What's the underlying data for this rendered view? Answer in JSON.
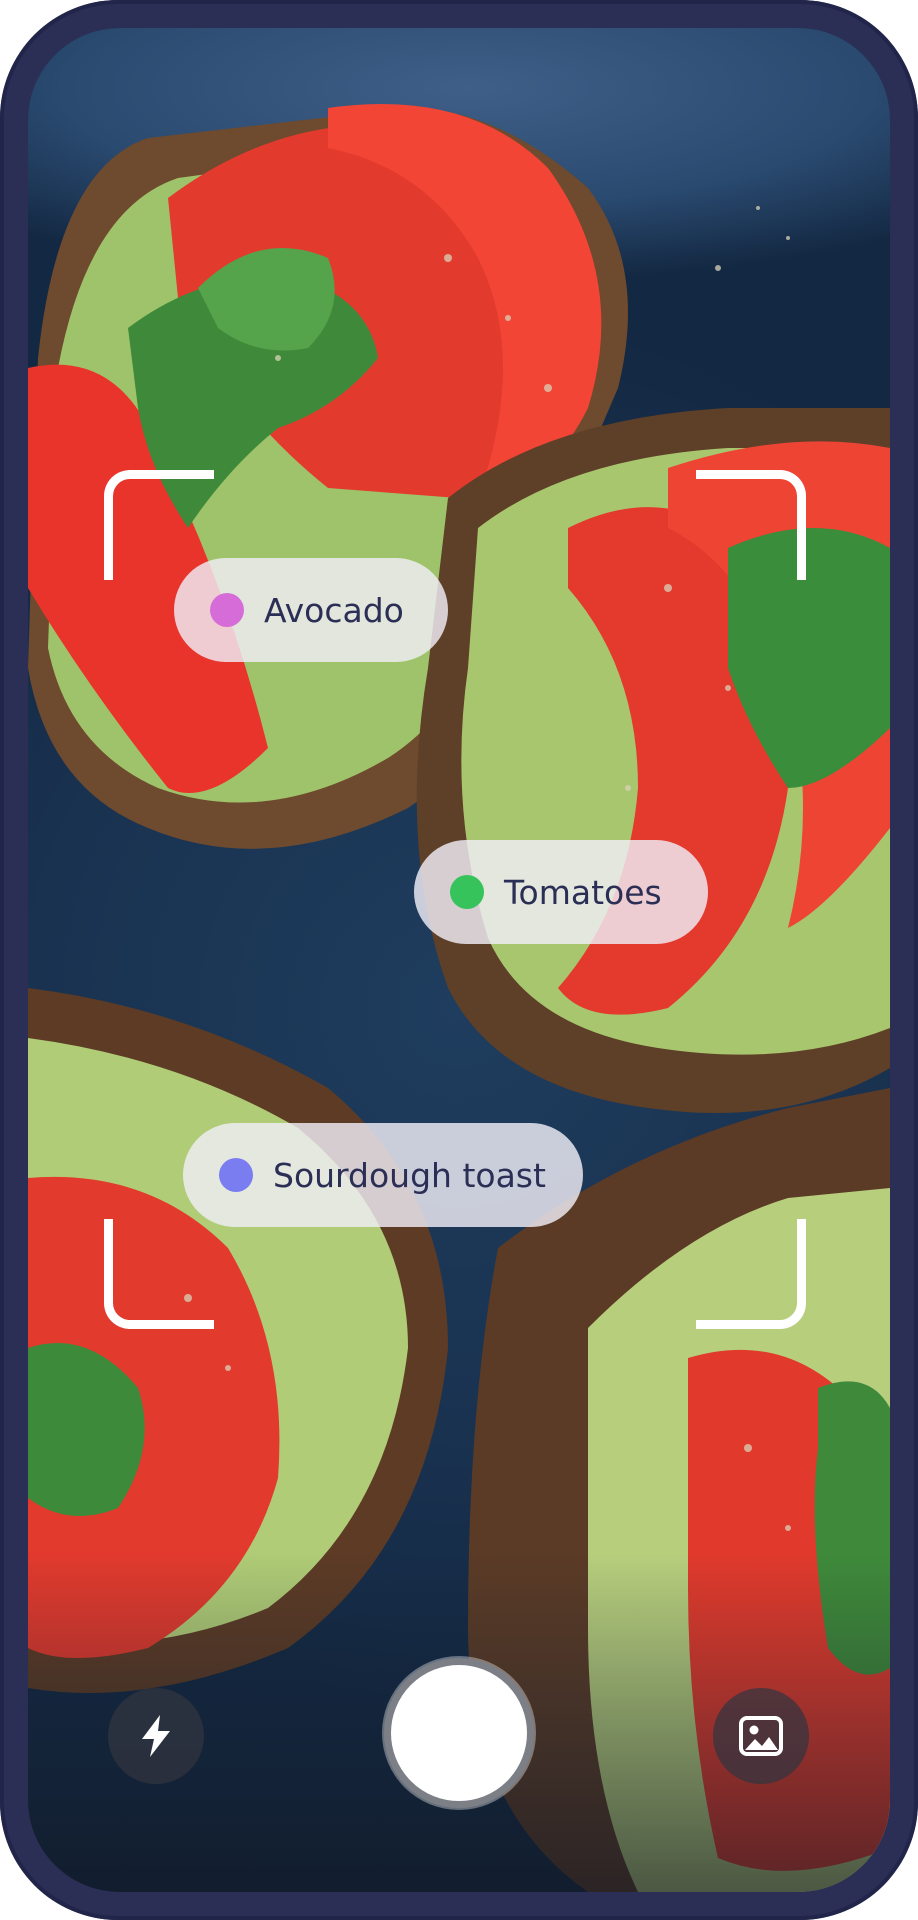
{
  "detections": [
    {
      "label": "Avocado",
      "color": "#d56cd8"
    },
    {
      "label": "Tomatoes",
      "color": "#37c35c"
    },
    {
      "label": "Sourdough toast",
      "color": "#7a7df0"
    }
  ],
  "controls": {
    "flash_icon": "flash-icon",
    "gallery_icon": "image-icon",
    "shutter": "shutter-button"
  },
  "colors": {
    "frame": "#2c2f55",
    "tag_text": "#2c2f55",
    "corner": "#ffffff"
  }
}
